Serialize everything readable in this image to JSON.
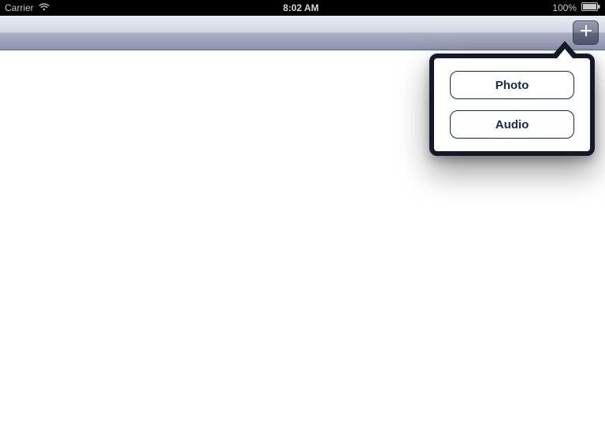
{
  "status_bar": {
    "carrier": "Carrier",
    "time": "8:02 AM",
    "battery_pct": "100%"
  },
  "popover": {
    "options": [
      {
        "label": "Photo"
      },
      {
        "label": "Audio"
      }
    ]
  }
}
